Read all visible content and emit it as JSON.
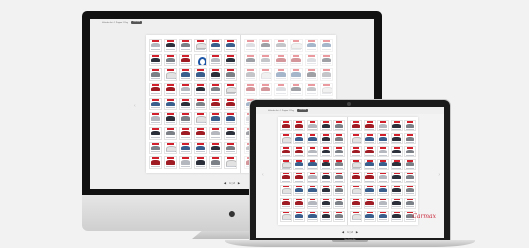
{
  "imac": {
    "toolbar": {
      "title": "Vehicles list - 1 Pagina 1 Pag",
      "button": "ONLINE"
    },
    "footer": {
      "prev": "◀",
      "page": "1 | 2",
      "next": "▶"
    }
  },
  "macbook": {
    "model_label": "MacBook Air",
    "toolbar": {
      "title": "Vehicles list - 1 Pagina 1 Pag",
      "button": "ONLINE"
    },
    "footer": {
      "prev": "◀",
      "page": "1 | 2",
      "next": "▶"
    },
    "brand_mark": "Carmax"
  },
  "icons": {
    "apple": "apple-logo-icon",
    "left_arrow": "chevron-left-icon",
    "right_arrow": "chevron-right-icon"
  },
  "colors": {
    "accent_red": "#d11f2b",
    "bmw_blue": "#1c55a5"
  }
}
